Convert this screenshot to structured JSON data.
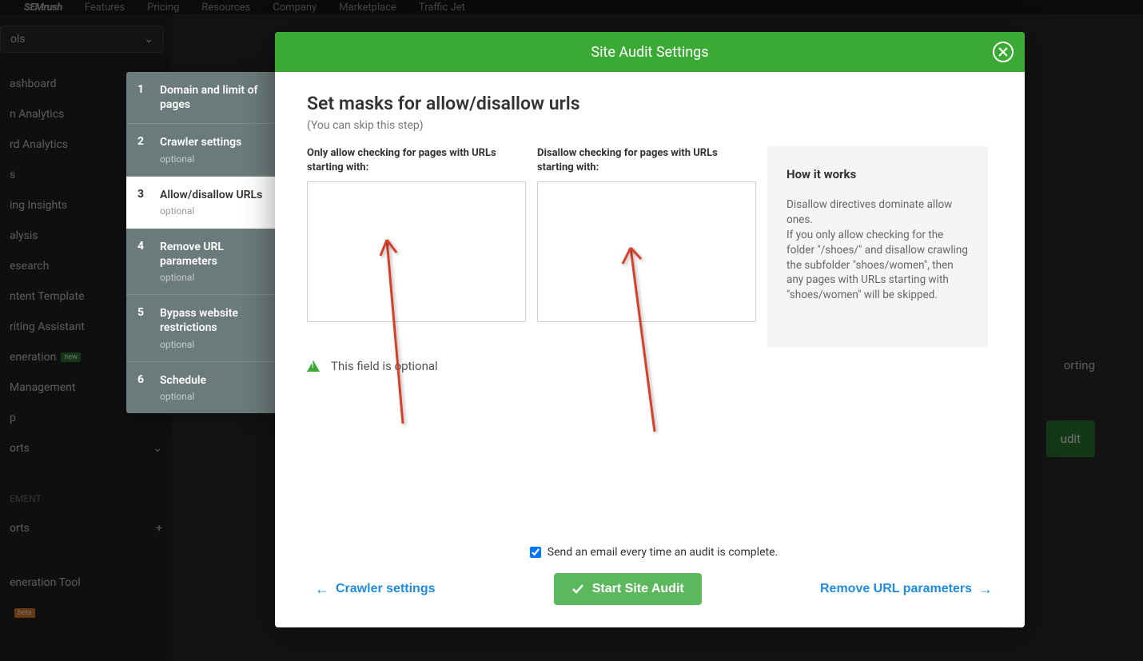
{
  "bg_header": {
    "logo": "SEMrush",
    "nav": [
      "Features",
      "Pricing",
      "Resources",
      "Company",
      "Marketplace",
      "Traffic Jet"
    ]
  },
  "bg_sidebar": {
    "tools": "ols",
    "items": [
      "ashboard",
      "n Analytics",
      "rd Analytics",
      "s",
      "ing Insights",
      "alysis",
      "esearch",
      "ntent Template",
      "riting Assistant",
      "eneration",
      "Management",
      "p",
      "orts"
    ],
    "section_label": "EMENT",
    "orts2": "orts",
    "gen_tool": "eneration Tool"
  },
  "bg_main": {
    "reporting": "orting",
    "audit_btn": "udit"
  },
  "steps": [
    {
      "num": "1",
      "title": "Domain and limit of pages",
      "optional": ""
    },
    {
      "num": "2",
      "title": "Crawler settings",
      "optional": "optional"
    },
    {
      "num": "3",
      "title": "Allow/disallow URLs",
      "optional": "optional"
    },
    {
      "num": "4",
      "title": "Remove URL parameters",
      "optional": "optional"
    },
    {
      "num": "5",
      "title": "Bypass website restrictions",
      "optional": "optional"
    },
    {
      "num": "6",
      "title": "Schedule",
      "optional": "optional"
    }
  ],
  "modal": {
    "header_title": "Site Audit Settings",
    "h2": "Set masks for allow/disallow urls",
    "skip": "(You can skip this step)",
    "allow_label": "Only allow checking for pages with URLs starting with:",
    "disallow_label": "Disallow checking for pages with URLs starting with:",
    "howit_title": "How it works",
    "howit_body": "Disallow directives dominate allow ones.\nIf you only allow checking for the folder \"/shoes/\" and disallow crawling the subfolder \"shoes/women\", then any pages with URLs starting with \"shoes/women\" will be skipped.",
    "optional_note": "This field is optional",
    "email_label": "Send an email every time an audit is complete.",
    "back_label": "Crawler settings",
    "primary_label": "Start Site Audit",
    "next_label": "Remove URL parameters"
  }
}
